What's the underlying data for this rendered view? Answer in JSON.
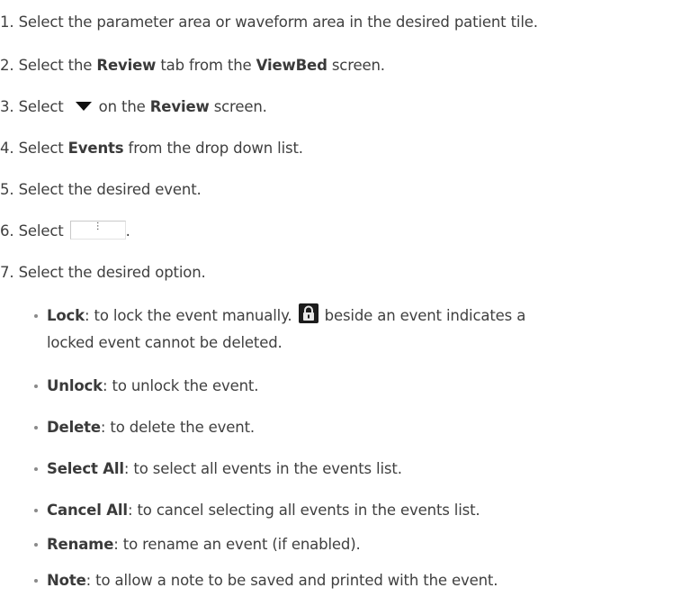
{
  "steps": [
    {
      "num": "1.",
      "text": "Select the parameter area or waveform area in the desired patient tile."
    },
    {
      "num": "2.",
      "pre": "Select the ",
      "b1": "Review",
      "mid": " tab from the ",
      "b2": "ViewBed",
      "post": " screen."
    },
    {
      "num": "3.",
      "pre": "Select ",
      "icon": "dropdown-triangle-icon",
      "mid": "on the ",
      "b1": "Review",
      "post": " screen."
    },
    {
      "num": "4.",
      "pre": "Select ",
      "b1": "Events",
      "post": " from the drop down list."
    },
    {
      "num": "5.",
      "text": "Select the desired event."
    },
    {
      "num": "6.",
      "pre": "Select ",
      "button_label": "⋮",
      "post": "."
    },
    {
      "num": "7.",
      "text": "Select the desired option."
    }
  ],
  "options": [
    {
      "term": "Lock",
      "desc": ": to lock the event manually. ",
      "desc_after_icon": " beside an event indicates a",
      "desc_line2": "locked event cannot be deleted.",
      "icon": "lock-icon"
    },
    {
      "term": "Unlock",
      "desc": ": to unlock the event."
    },
    {
      "term": "Delete",
      "desc": ": to delete the event."
    },
    {
      "term": "Select All",
      "desc": ": to select all events in the events list."
    },
    {
      "term": "Cancel All",
      "desc": ": to cancel selecting all events in the events list."
    },
    {
      "term": "Rename",
      "desc": ": to rename an event (if enabled)."
    },
    {
      "term": "Note",
      "desc": ": to allow a note to be saved and printed with the event."
    }
  ]
}
